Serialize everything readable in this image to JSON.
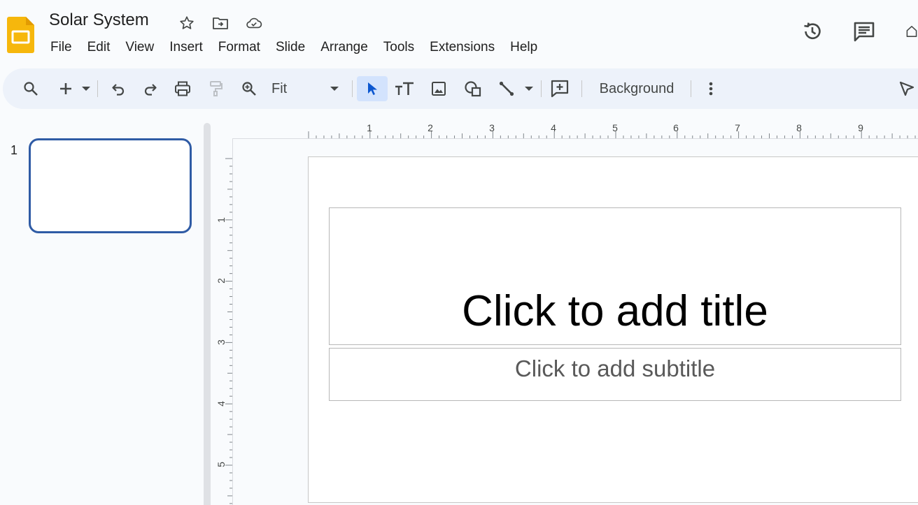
{
  "app": {
    "doc_title": "Solar System",
    "brand_color": "#f6b70c",
    "accent_color": "#2f5ba5"
  },
  "menu": [
    "File",
    "Edit",
    "View",
    "Insert",
    "Format",
    "Slide",
    "Arrange",
    "Tools",
    "Extensions",
    "Help"
  ],
  "header_icons": [
    "star-icon",
    "move-to-folder-icon",
    "cloud-saved-icon",
    "version-history-icon",
    "comments-icon",
    "home-icon"
  ],
  "toolbar": {
    "zoom_value": "Fit",
    "background_label": "Background",
    "icons": [
      "search-menus-icon",
      "new-slide-icon",
      "undo-icon",
      "redo-icon",
      "print-icon",
      "paint-format-icon",
      "zoom-icon",
      "select-icon",
      "text-box-icon",
      "image-icon",
      "shape-icon",
      "line-icon",
      "comment-add-icon",
      "more-icon",
      "cursor-icon"
    ]
  },
  "filmstrip": {
    "slides": [
      {
        "number": "1"
      }
    ]
  },
  "rulers": {
    "horizontal_labels": [
      "1",
      "2",
      "3",
      "4",
      "5",
      "6",
      "7",
      "8",
      "9"
    ],
    "vertical_labels": [
      "1",
      "2",
      "3",
      "4",
      "5"
    ]
  },
  "slide": {
    "title_placeholder": "Click to add title",
    "subtitle_placeholder": "Click to add subtitle"
  }
}
